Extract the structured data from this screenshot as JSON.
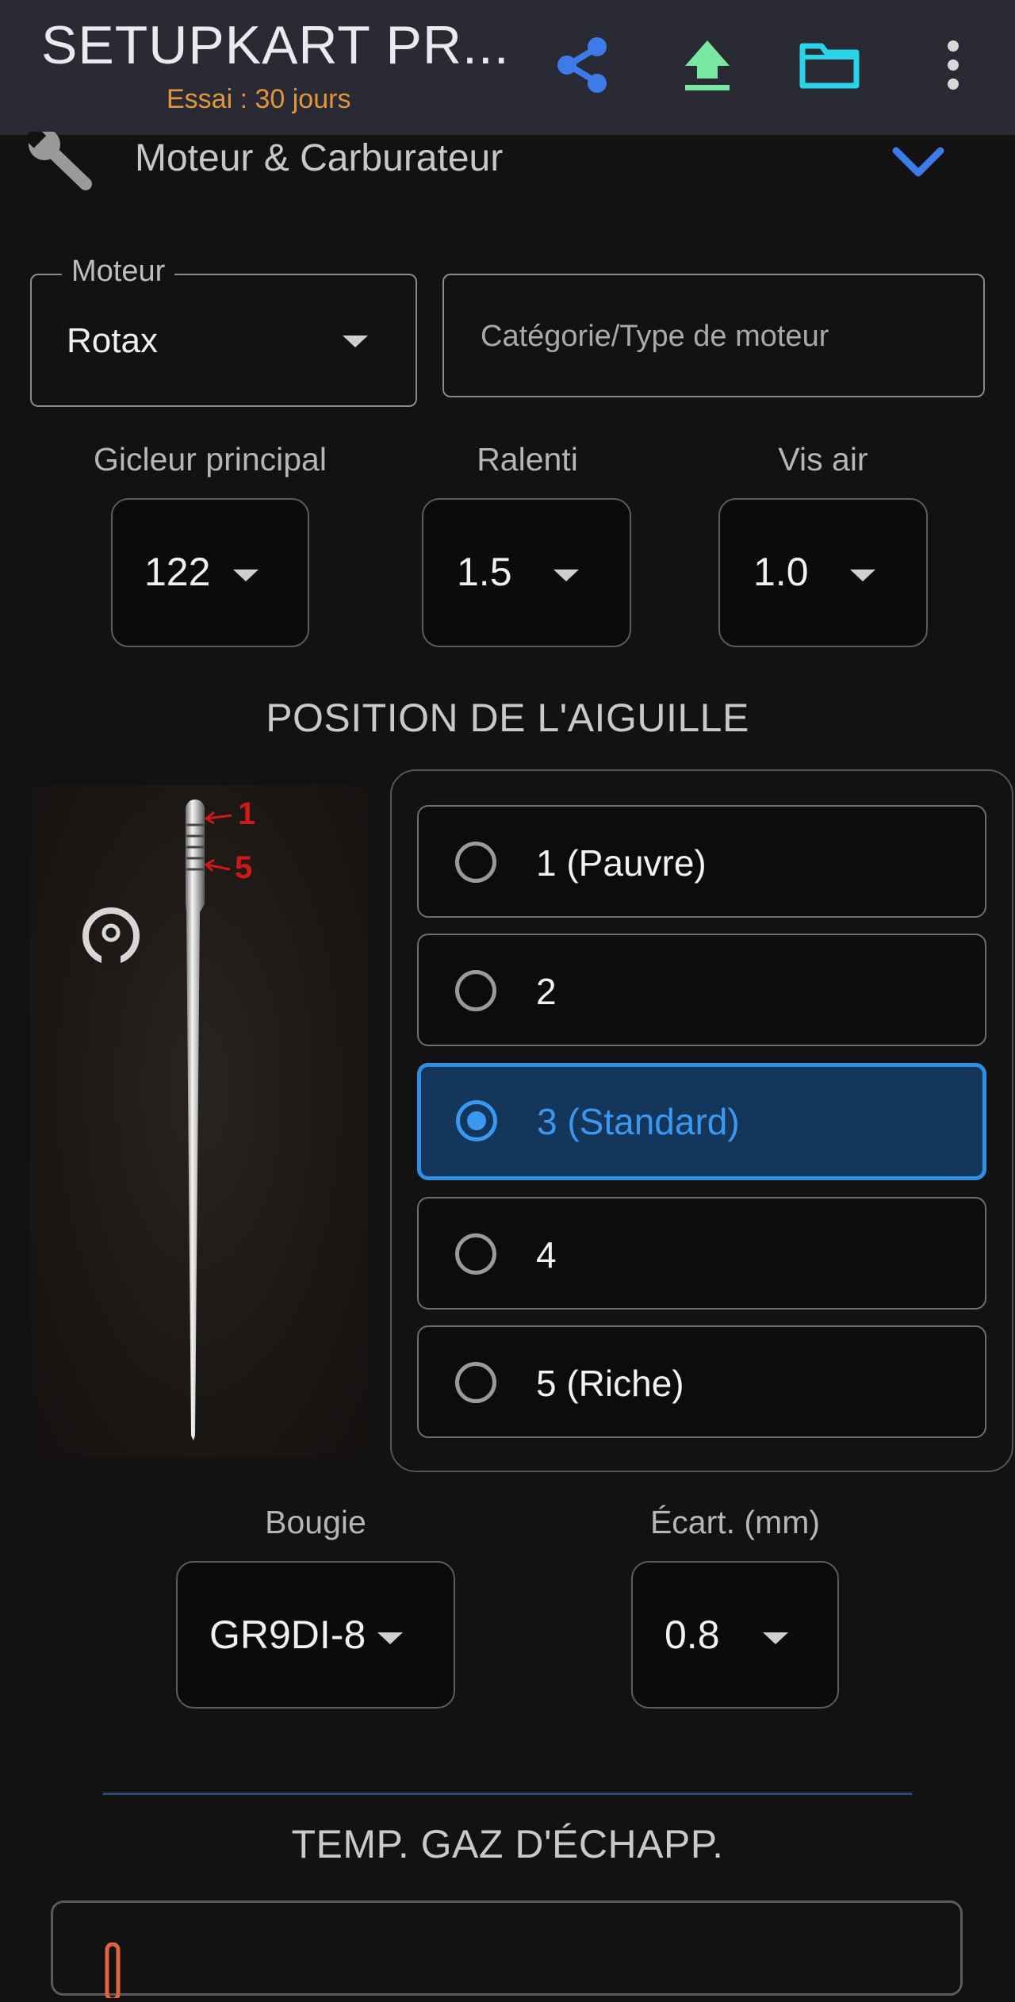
{
  "app": {
    "title": "SETUPKART PR...",
    "trial": "Essai : 30 jours",
    "icons": [
      "share-icon",
      "upload-icon",
      "folder-icon",
      "more-vert-icon"
    ],
    "colors": {
      "share": "#3d7be8",
      "upload": "#79e7a2",
      "folder": "#29d3ea",
      "trial": "#e2963c",
      "accent": "#2f8fe6"
    }
  },
  "section": {
    "icon": "wrench-icon",
    "title": "Moteur & Carburateur",
    "expand_icon": "chevron-down-icon"
  },
  "engine": {
    "label": "Moteur",
    "value": "Rotax",
    "category_placeholder": "Catégorie/Type de moteur"
  },
  "carb": {
    "main_jet_label": "Gicleur principal",
    "main_jet_value": "122",
    "idle_label": "Ralenti",
    "idle_value": "1.5",
    "air_screw_label": "Vis air",
    "air_screw_value": "1.0"
  },
  "needle": {
    "heading": "POSITION DE L'AIGUILLE",
    "marker_top": "1",
    "marker_bottom": "5",
    "options": [
      "1 (Pauvre)",
      "2",
      "3 (Standard)",
      "4",
      "5 (Riche)"
    ],
    "selected": "3 (Standard)"
  },
  "spark": {
    "plug_label": "Bougie",
    "plug_value": "GR9DI-8",
    "gap_label": "Écart. (mm)",
    "gap_value": "0.8"
  },
  "egt": {
    "heading": "TEMP. GAZ D'ÉCHAPP."
  }
}
